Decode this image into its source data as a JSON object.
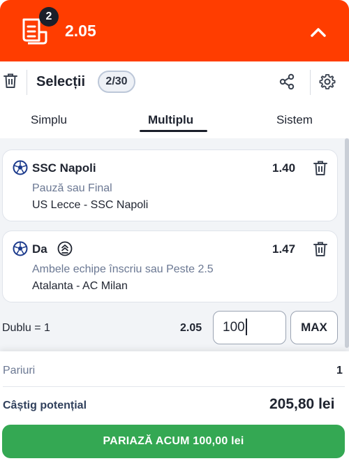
{
  "header": {
    "badge_count": "2",
    "total_odds": "2.05",
    "accent_color": "#ff3d00"
  },
  "topbar": {
    "title": "Selecții",
    "count": "2/30",
    "icons": [
      "trash-icon",
      "share-icon",
      "gear-icon"
    ]
  },
  "tabs": [
    {
      "label": "Simplu",
      "active": false
    },
    {
      "label": "Multiplu",
      "active": true
    },
    {
      "label": "Sistem",
      "active": false
    }
  ],
  "selections": [
    {
      "name": "SSC Napoli",
      "odds": "1.40",
      "market": "Pauză sau Final",
      "match": "US Lecce - SSC Napoli",
      "boost": false
    },
    {
      "name": "Da",
      "odds": "1.47",
      "market": "Ambele echipe înscriu sau Peste 2.5",
      "match": "Atalanta - AC Milan",
      "boost": true
    }
  ],
  "stake": {
    "label": "Dublu = 1",
    "odds": "2.05",
    "value": "100",
    "max_label": "MAX"
  },
  "summary": {
    "bets_label": "Pariuri",
    "bets_value": "1",
    "win_label": "Câștig potențial",
    "win_value": "205,80 lei"
  },
  "place_bet_label": "PARIAZĂ ACUM 100,00 lei",
  "colors": {
    "button": "#34a853",
    "header": "#ff3d00"
  }
}
